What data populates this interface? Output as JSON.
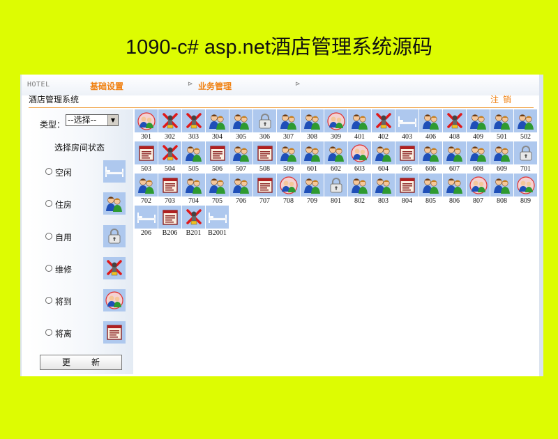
{
  "banner_title": "1090-c# asp.net酒店管理系统源码",
  "header": {
    "brand": "HOTEL",
    "menu": [
      "基础设置",
      "业务管理"
    ],
    "arrow": "⊳",
    "system_name": "酒店管理系统",
    "logout": "注销"
  },
  "sidebar": {
    "type_label": "类型：",
    "type_select_value": "--选择--",
    "status_title": "选择房间状态",
    "statuses": [
      {
        "label": "空闲",
        "icon": "bed-icon"
      },
      {
        "label": "住房",
        "icon": "occupied-guests-icon"
      },
      {
        "label": "自用",
        "icon": "padlock-icon"
      },
      {
        "label": "维修",
        "icon": "repair-icon"
      },
      {
        "label": "将到",
        "icon": "arriving-icon"
      },
      {
        "label": "将离",
        "icon": "leaving-icon"
      }
    ],
    "refresh_label": "更新"
  },
  "rooms": [
    {
      "num": "301",
      "status": "arriving"
    },
    {
      "num": "302",
      "status": "repair"
    },
    {
      "num": "303",
      "status": "repair"
    },
    {
      "num": "304",
      "status": "occupied"
    },
    {
      "num": "305",
      "status": "occupied"
    },
    {
      "num": "306",
      "status": "self"
    },
    {
      "num": "307",
      "status": "occupied"
    },
    {
      "num": "308",
      "status": "occupied"
    },
    {
      "num": "309",
      "status": "arriving"
    },
    {
      "num": "401",
      "status": "occupied"
    },
    {
      "num": "402",
      "status": "repair"
    },
    {
      "num": "403",
      "status": "vacant"
    },
    {
      "num": "406",
      "status": "occupied"
    },
    {
      "num": "408",
      "status": "repair"
    },
    {
      "num": "409",
      "status": "occupied"
    },
    {
      "num": "501",
      "status": "occupied"
    },
    {
      "num": "502",
      "status": "occupied"
    },
    {
      "num": "503",
      "status": "leaving"
    },
    {
      "num": "504",
      "status": "repair"
    },
    {
      "num": "505",
      "status": "occupied"
    },
    {
      "num": "506",
      "status": "leaving"
    },
    {
      "num": "507",
      "status": "occupied"
    },
    {
      "num": "508",
      "status": "leaving"
    },
    {
      "num": "509",
      "status": "occupied"
    },
    {
      "num": "601",
      "status": "occupied"
    },
    {
      "num": "602",
      "status": "occupied"
    },
    {
      "num": "603",
      "status": "arriving"
    },
    {
      "num": "604",
      "status": "occupied"
    },
    {
      "num": "605",
      "status": "leaving"
    },
    {
      "num": "606",
      "status": "occupied"
    },
    {
      "num": "607",
      "status": "occupied"
    },
    {
      "num": "608",
      "status": "occupied"
    },
    {
      "num": "609",
      "status": "occupied"
    },
    {
      "num": "701",
      "status": "self"
    },
    {
      "num": "702",
      "status": "occupied"
    },
    {
      "num": "703",
      "status": "leaving"
    },
    {
      "num": "704",
      "status": "occupied"
    },
    {
      "num": "705",
      "status": "occupied"
    },
    {
      "num": "706",
      "status": "occupied"
    },
    {
      "num": "707",
      "status": "leaving"
    },
    {
      "num": "708",
      "status": "arriving"
    },
    {
      "num": "709",
      "status": "occupied"
    },
    {
      "num": "801",
      "status": "self"
    },
    {
      "num": "802",
      "status": "occupied"
    },
    {
      "num": "803",
      "status": "occupied"
    },
    {
      "num": "804",
      "status": "leaving"
    },
    {
      "num": "805",
      "status": "occupied"
    },
    {
      "num": "806",
      "status": "occupied"
    },
    {
      "num": "807",
      "status": "arriving"
    },
    {
      "num": "808",
      "status": "occupied"
    },
    {
      "num": "809",
      "status": "arriving"
    },
    {
      "num": "206",
      "status": "vacant"
    },
    {
      "num": "B206",
      "status": "leaving"
    },
    {
      "num": "B201",
      "status": "repair"
    },
    {
      "num": "B2001",
      "status": "vacant"
    }
  ],
  "colors": {
    "background": "#ddfc02",
    "accent": "#f08010",
    "tile": "#aec8ee"
  }
}
